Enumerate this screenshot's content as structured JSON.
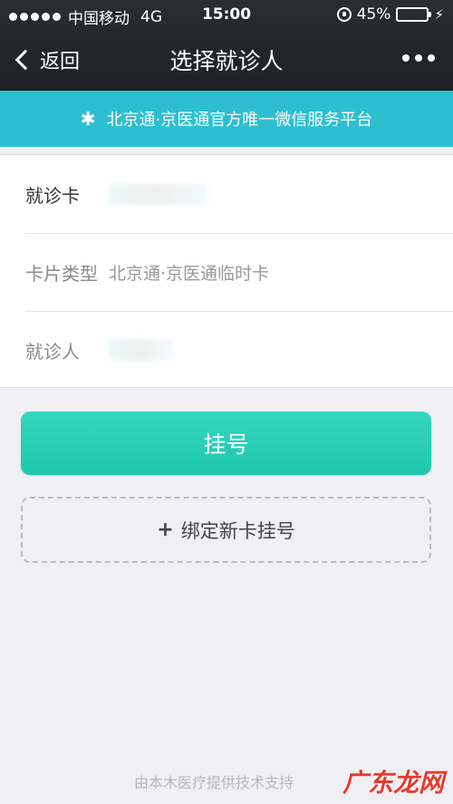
{
  "status_bar": {
    "carrier": "中国移动",
    "network": "4G",
    "time": "15:00",
    "battery": "45%"
  },
  "nav": {
    "back_label": "返回",
    "title": "选择就诊人"
  },
  "banner": {
    "text": "北京通·京医通官方唯一微信服务平台"
  },
  "info": {
    "card_label": "就诊卡",
    "card_type_label": "卡片类型",
    "card_type_value": "北京通·京医通临时卡",
    "patient_label": "就诊人"
  },
  "actions": {
    "register_label": "挂号",
    "bind_label": "绑定新卡挂号"
  },
  "footer": {
    "text": "由本木医疗提供技术支持"
  },
  "watermark": {
    "text": "广东龙网"
  },
  "colors": {
    "accent": "#2dbfd1",
    "button": "#26ccb2",
    "battery": "#4cd964"
  }
}
